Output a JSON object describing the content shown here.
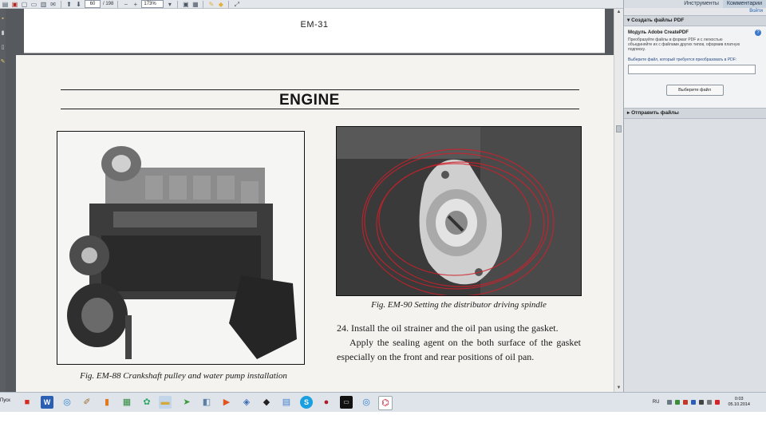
{
  "toolbar": {
    "page_number": "60",
    "page_total": "/ 198",
    "zoom": "173%"
  },
  "right_pane": {
    "tabs": [
      "Инструменты",
      "Комментарии"
    ],
    "login": "Войти",
    "create_pdf": {
      "header": "Создать файлы PDF",
      "title": "Модуль Adobe CreatePDF",
      "description": "Преобразуйте файлы в формат PDF и с легкостью объединяйте их с файлами других типов, оформив платную подписку.",
      "prompt": "Выберите файл, который требуется преобразовать в PDF:",
      "button": "Выберите файл"
    },
    "send_files": {
      "header": "Отправить файлы"
    }
  },
  "document": {
    "prev_page_number": "EM-31",
    "section_heading": "ENGINE",
    "caption_left": "Fig. EM-88  Crankshaft pulley and water pump installation",
    "caption_right": "Fig. EM-90  Setting the distributor driving spindle",
    "paragraph_1": "24.  Install the oil strainer and the oil pan using the gasket.",
    "paragraph_2": "Apply the sealing agent on the both surface of the gasket especially on the front and rear positions of oil pan."
  },
  "taskbar": {
    "start_label": "Пуск",
    "language": "RU",
    "time": "0:03",
    "date": "05.10.2014"
  }
}
